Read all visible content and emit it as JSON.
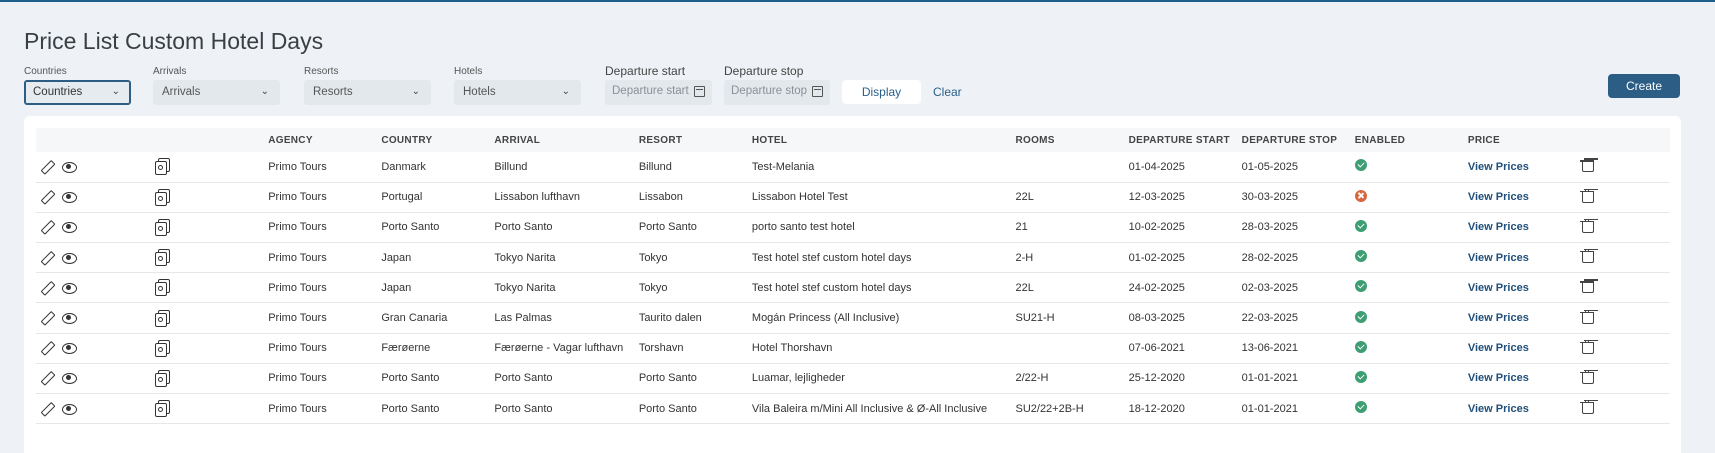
{
  "page": {
    "title": "Price List Custom Hotel Days"
  },
  "filters": {
    "countries": {
      "label": "Countries",
      "value": "Countries"
    },
    "arrivals": {
      "label": "Arrivals",
      "value": "Arrivals"
    },
    "resorts": {
      "label": "Resorts",
      "value": "Resorts"
    },
    "hotels": {
      "label": "Hotels",
      "value": "Hotels"
    },
    "departure_start": {
      "label": "Departure start",
      "placeholder": "Departure start"
    },
    "departure_stop": {
      "label": "Departure stop",
      "placeholder": "Departure stop"
    }
  },
  "actions": {
    "display": "Display",
    "clear": "Clear",
    "create": "Create"
  },
  "table": {
    "headers": [
      "AGENCY",
      "COUNTRY",
      "ARRIVAL",
      "RESORT",
      "HOTEL",
      "ROOMS",
      "DEPARTURE START",
      "DEPARTURE STOP",
      "ENABLED",
      "PRICE"
    ],
    "view_prices_label": "View Prices",
    "rows": [
      {
        "agency": "Primo Tours",
        "country": "Danmark",
        "arrival": "Billund",
        "resort": "Billund",
        "hotel": "Test-Melania",
        "rooms": "",
        "start": "01-04-2025",
        "stop": "01-05-2025",
        "enabled": true
      },
      {
        "agency": "Primo Tours",
        "country": "Portugal",
        "arrival": "Lissabon lufthavn",
        "resort": "Lissabon",
        "hotel": "Lissabon Hotel Test",
        "rooms": "22L",
        "start": "12-03-2025",
        "stop": "30-03-2025",
        "enabled": false
      },
      {
        "agency": "Primo Tours",
        "country": "Porto Santo",
        "arrival": "Porto Santo",
        "resort": "Porto Santo",
        "hotel": "porto santo test hotel",
        "rooms": "21",
        "start": "10-02-2025",
        "stop": "28-03-2025",
        "enabled": true
      },
      {
        "agency": "Primo Tours",
        "country": "Japan",
        "arrival": "Tokyo Narita",
        "resort": "Tokyo",
        "hotel": "Test hotel stef custom hotel days",
        "rooms": "2-H",
        "start": "01-02-2025",
        "stop": "28-02-2025",
        "enabled": true
      },
      {
        "agency": "Primo Tours",
        "country": "Japan",
        "arrival": "Tokyo Narita",
        "resort": "Tokyo",
        "hotel": "Test hotel stef custom hotel days",
        "rooms": "22L",
        "start": "24-02-2025",
        "stop": "02-03-2025",
        "enabled": true
      },
      {
        "agency": "Primo Tours",
        "country": "Gran Canaria",
        "arrival": "Las Palmas",
        "resort": "Taurito dalen",
        "hotel": "Mogán Princess (All Inclusive)",
        "rooms": "SU21-H",
        "start": "08-03-2025",
        "stop": "22-03-2025",
        "enabled": true
      },
      {
        "agency": "Primo Tours",
        "country": "Færøerne",
        "arrival": "Færøerne - Vagar lufthavn",
        "resort": "Torshavn",
        "hotel": "Hotel Thorshavn",
        "rooms": "",
        "start": "07-06-2021",
        "stop": "13-06-2021",
        "enabled": true
      },
      {
        "agency": "Primo Tours",
        "country": "Porto Santo",
        "arrival": "Porto Santo",
        "resort": "Porto Santo",
        "hotel": "Luamar, lejligheder",
        "rooms": "2/22-H",
        "start": "25-12-2020",
        "stop": "01-01-2021",
        "enabled": true
      },
      {
        "agency": "Primo Tours",
        "country": "Porto Santo",
        "arrival": "Porto Santo",
        "resort": "Porto Santo",
        "hotel": "Vila Baleira m/Mini All Inclusive & Ø-All Inclusive",
        "rooms": "SU2/22+2B-H",
        "start": "18-12-2020",
        "stop": "01-01-2021",
        "enabled": true
      }
    ]
  },
  "colors": {
    "primary": "#2c5d85",
    "enabled": "#3d9e73",
    "disabled": "#d9663f"
  }
}
